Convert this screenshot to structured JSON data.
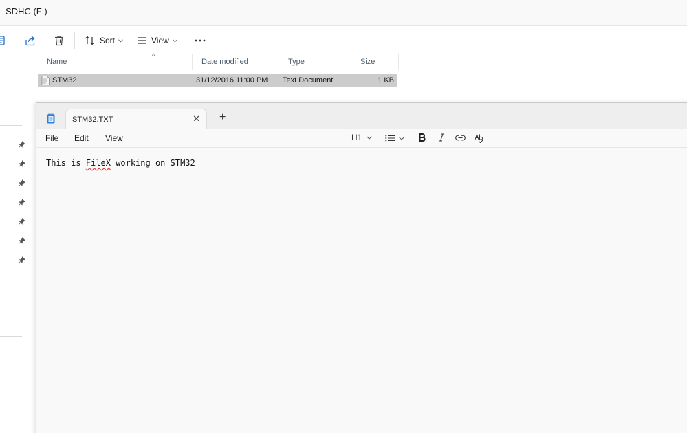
{
  "explorer": {
    "title": "SDHC (F:)",
    "toolbar": {
      "sort_label": "Sort",
      "view_label": "View"
    },
    "columns": [
      "Name",
      "Date modified",
      "Type",
      "Size"
    ],
    "files": [
      {
        "name": "STM32",
        "date_modified": "31/12/2016 11:00 PM",
        "type": "Text Document",
        "size": "1 KB"
      }
    ]
  },
  "notepad": {
    "tab_title": "STM32.TXT",
    "menu": [
      "File",
      "Edit",
      "View"
    ],
    "heading_label": "H1",
    "content": {
      "before": "This is ",
      "misspelled": "FileX",
      "after": " working on STM32"
    }
  }
}
